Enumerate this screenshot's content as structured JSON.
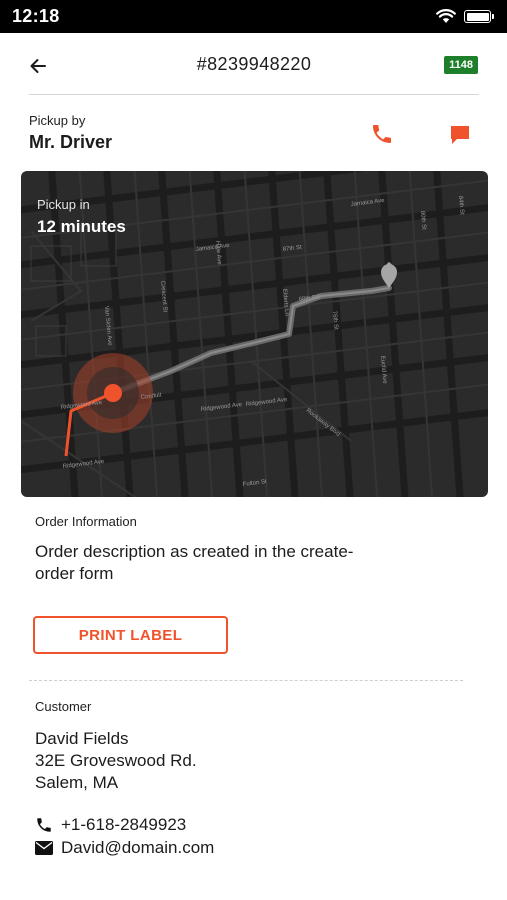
{
  "status_bar": {
    "time": "12:18",
    "icons": [
      "wifi-icon",
      "battery-icon"
    ]
  },
  "header": {
    "order_number": "#8239948220",
    "badge": "1148",
    "back_icon": "arrow-left-icon"
  },
  "pickup": {
    "label": "Pickup by",
    "driver_name": "Mr. Driver",
    "call_icon": "phone-icon",
    "chat_icon": "chat-icon"
  },
  "map": {
    "overlay_label": "Pickup in",
    "overlay_time": "12 minutes",
    "street_labels": [
      "Jamaica Ave",
      "Jamaica Ave",
      "87th St",
      "Ridgewood Ave",
      "Ridgewood Ave",
      "Rockaway Blvd",
      "Fulton St",
      "Euclid Ave",
      "Hale Ave",
      "Crescent St",
      "Van Siclen Ave",
      "80th St",
      "84th St",
      "76th St",
      "68th Rd",
      "Elderts Ln",
      "Ridgewood Ave",
      "Conduit",
      "Ridgewood Ave"
    ]
  },
  "order": {
    "section_label": "Order Information",
    "description": "Order description as created in the create-order form",
    "print_button": "PRINT LABEL"
  },
  "customer": {
    "section_label": "Customer",
    "name": "David Fields",
    "address_line1": "32E Groveswood Rd.",
    "address_line2": "Salem, MA",
    "phone": "+1-618-2849923",
    "email": "David@domain.com"
  },
  "colors": {
    "accent": "#f0532c",
    "badge": "#1e7f2b",
    "map_bg": "#2b2b2b"
  }
}
